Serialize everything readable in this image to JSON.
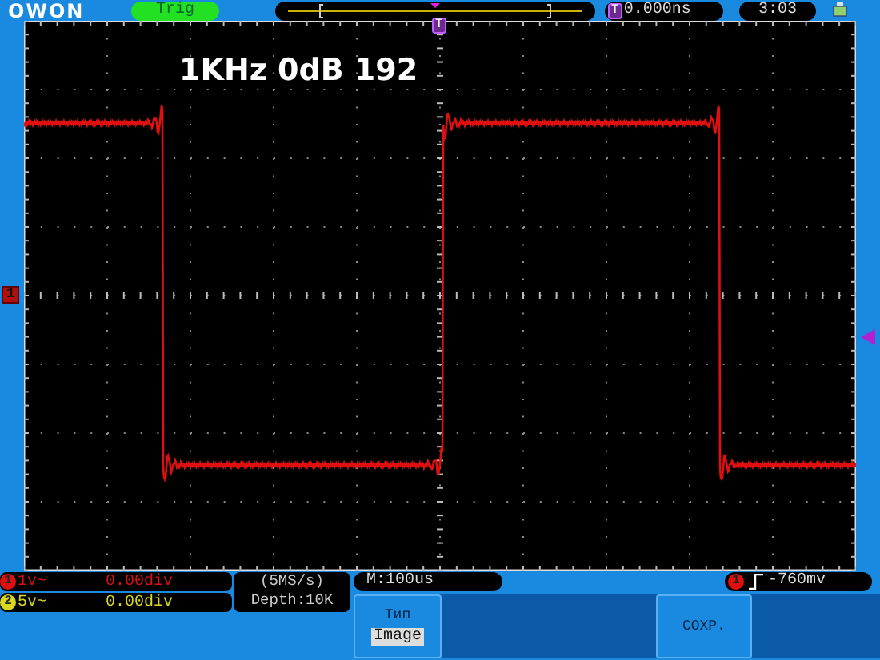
{
  "header": {
    "logo": "OWON",
    "trigger_status": "Trig",
    "trigger_time_marker": "T",
    "trigger_time": "0.000ns",
    "clock": "3:03"
  },
  "screen": {
    "overlay_text": "1KHz 0dB 192",
    "trigger_marker": "T",
    "channel_marker": "1"
  },
  "channels": [
    {
      "number": "1",
      "scale": "1v~",
      "offset": "0.00div",
      "color": "#e01010"
    },
    {
      "number": "2",
      "scale": "5v~",
      "offset": "0.00div",
      "color": "#d8d820"
    }
  ],
  "acquisition": {
    "sample_rate": "(5MS/s)",
    "depth": "Depth:10K"
  },
  "timebase": "M:100us",
  "trigger": {
    "channel": "1",
    "level": "-760mv"
  },
  "menu": [
    {
      "kind": "option",
      "label": "Тип",
      "value": "Image"
    },
    {
      "kind": "action",
      "label": "СОХР."
    }
  ]
}
